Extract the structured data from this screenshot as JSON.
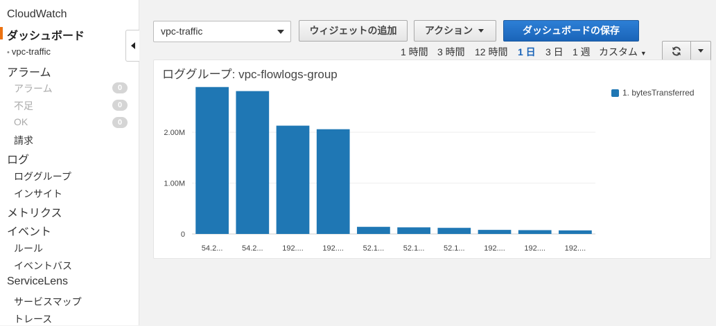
{
  "sidebar": {
    "title": "CloudWatch",
    "dashboards_label": "ダッシュボード",
    "current_dashboard": "vpc-traffic",
    "alarms_label": "アラーム",
    "alarm_items": [
      {
        "label": "アラーム",
        "count": "0"
      },
      {
        "label": "不足",
        "count": "0"
      },
      {
        "label": "OK",
        "count": "0"
      }
    ],
    "billing_label": "請求",
    "logs_label": "ログ",
    "log_items": [
      "ロググループ",
      "インサイト"
    ],
    "metrics_label": "メトリクス",
    "events_label": "イベント",
    "event_items": [
      "ルール",
      "イベントバス"
    ],
    "servicelens_label": "ServiceLens",
    "servicelens_items": [
      "サービスマップ",
      "トレース"
    ]
  },
  "toolbar": {
    "dashboard_select": "vpc-traffic",
    "add_widget": "ウィジェットの追加",
    "actions": "アクション",
    "save_dashboard": "ダッシュボードの保存"
  },
  "time_range": {
    "options": [
      "1 時間",
      "3 時間",
      "12 時間",
      "1 日",
      "3 日",
      "1 週",
      "カスタム"
    ],
    "selected": "1 日"
  },
  "widget": {
    "title": "ロググループ: vpc-flowlogs-group",
    "legend": "1. bytesTransferred"
  },
  "chart_data": {
    "type": "bar",
    "title": "ロググループ: vpc-flowlogs-group",
    "categories": [
      "54.2...",
      "54.2...",
      "192....",
      "192....",
      "52.1...",
      "52.1...",
      "52.1...",
      "192....",
      "192....",
      "192...."
    ],
    "series": [
      {
        "name": "1. bytesTransferred",
        "values": [
          2890000,
          2810000,
          2130000,
          2060000,
          140000,
          130000,
          120000,
          80000,
          75000,
          70000
        ]
      }
    ],
    "yticks": [
      "0",
      "1.00M",
      "2.00M"
    ],
    "ylim": [
      0,
      2900000
    ],
    "grid": true,
    "legend_position": "right",
    "color": "#1f77b4"
  }
}
